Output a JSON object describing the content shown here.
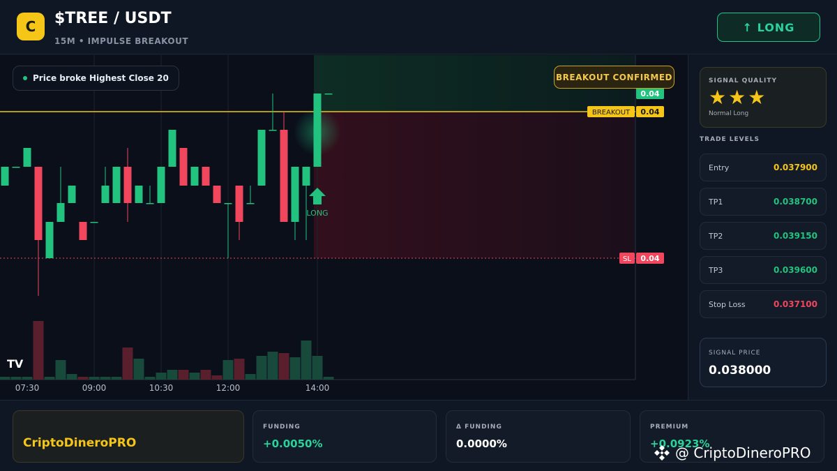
{
  "header": {
    "logo_letter": "C",
    "pair": "$TREE / USDT",
    "subtitle": "15M • IMPULSE BREAKOUT",
    "direction_button": "↑ LONG"
  },
  "chart": {
    "chip_text": "Price broke Highest Close 20",
    "confirmed_badge": "BREAKOUT CONFIRMED",
    "top_price_tag": "0.04",
    "breakout_label": "BREAKOUT",
    "breakout_price": "0.04",
    "sl_label": "SL",
    "sl_price": "0.04",
    "marker_label": "LONG",
    "tv_logo": "TV",
    "time_axis": [
      "07:30",
      "09:00",
      "10:30",
      "12:00",
      "14:00"
    ],
    "colors": {
      "up": "#22c37f",
      "down": "#f0465e",
      "breakout": "#f5c518",
      "sl": "#f0465e"
    }
  },
  "sidebar": {
    "quality_title": "SIGNAL QUALITY",
    "stars": "★★★",
    "quality_sub": "Normal Long",
    "levels_title": "TRADE LEVELS",
    "levels": [
      {
        "label": "Entry",
        "value": "0.037900",
        "color": "#f5c518"
      },
      {
        "label": "TP1",
        "value": "0.038700",
        "color": "#22c37f"
      },
      {
        "label": "TP2",
        "value": "0.039150",
        "color": "#22c37f"
      },
      {
        "label": "TP3",
        "value": "0.039600",
        "color": "#22c37f"
      },
      {
        "label": "Stop Loss",
        "value": "0.037100",
        "color": "#f0465e"
      }
    ],
    "signal_price_title": "SIGNAL PRICE",
    "signal_price": "0.038000"
  },
  "bottom": {
    "brand": "CriptoDineroPRO",
    "stats": [
      {
        "title": "FUNDING",
        "value": "+0.0050%",
        "color": "#2ad39a"
      },
      {
        "title": "Δ FUNDING",
        "value": "0.0000%",
        "color": "#ffffff"
      },
      {
        "title": "PREMIUM",
        "value": "+0.0923%",
        "color": "#2ad39a"
      }
    ],
    "watermark": "@ CriptoDineroPRO"
  }
}
